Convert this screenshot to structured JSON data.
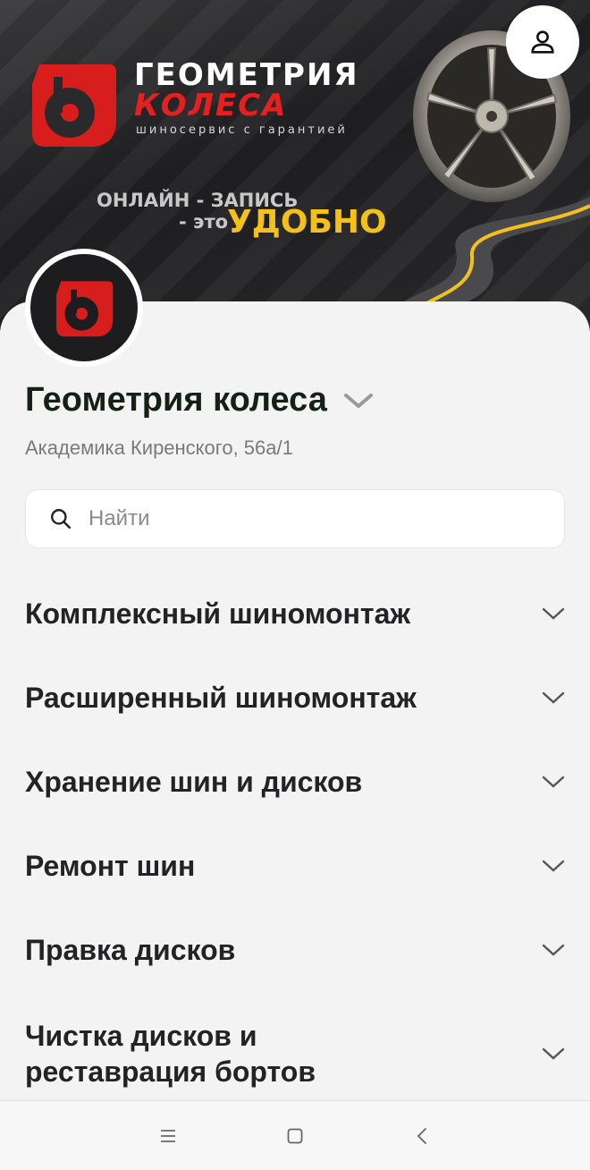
{
  "banner": {
    "brand_title": "ГЕОМЕТРИЯ",
    "brand_subtitle": "КОЛЕСА",
    "brand_tagline": "шиносервис с гарантией",
    "promo_line1": "ОНЛАЙН - ЗАПИСЬ",
    "promo_line2": "- это",
    "promo_accent": "УДОБНО"
  },
  "place": {
    "name": "Геометрия колеса",
    "address": "Академика Киренского, 56а/1"
  },
  "search": {
    "placeholder": "Найти"
  },
  "categories": [
    {
      "label": "Комплексный шиномонтаж"
    },
    {
      "label": "Расширенный шиномонтаж"
    },
    {
      "label": "Хранение шин и дисков"
    },
    {
      "label": "Ремонт шин"
    },
    {
      "label": "Правка дисков"
    },
    {
      "label": "Чистка дисков и реставрация бортов"
    }
  ],
  "colors": {
    "brand_red": "#e62020",
    "accent_yellow": "#f3c11a",
    "title_text": "#152016"
  },
  "icons": {
    "profile": "person-icon",
    "search": "search-icon",
    "expand": "chevron-down-icon",
    "nav_menu": "menu-icon",
    "nav_home": "square-icon",
    "nav_back": "back-chevron-icon"
  }
}
